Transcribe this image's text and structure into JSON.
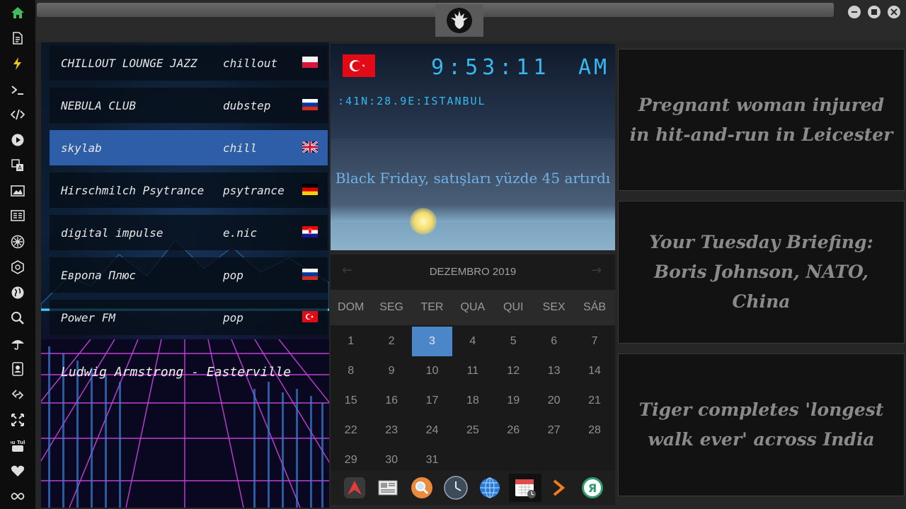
{
  "rail": {
    "icons": [
      "home-icon",
      "document-icon",
      "bolt-icon",
      "terminal-icon",
      "code-icon",
      "play-icon",
      "translate-icon",
      "image-icon",
      "newspaper-icon",
      "rebel-icon",
      "empire-icon",
      "globe-icon",
      "search-icon",
      "umbrella-icon",
      "contacts-icon",
      "link-icon",
      "expand-icon",
      "youtube-icon",
      "heart-icon",
      "infinity-icon"
    ],
    "youtube_label": "You Tube"
  },
  "radio": {
    "stations": [
      {
        "name": "CHILLOUT LOUNGE JAZZ",
        "genre": "chillout",
        "flag": "poland-flag"
      },
      {
        "name": "NEBULA CLUB",
        "genre": "dubstep",
        "flag": "russia-flag"
      },
      {
        "name": "skylab",
        "genre": "chill",
        "flag": "uk-flag"
      },
      {
        "name": "Hirschmilch Psytrance",
        "genre": "psytrance",
        "flag": "germany-flag"
      },
      {
        "name": "digital impulse",
        "genre": "e.nic",
        "flag": "croatia-flag"
      },
      {
        "name": "Европа Плюс",
        "genre": "pop",
        "flag": "russia-flag"
      },
      {
        "name": "Power FM",
        "genre": "pop",
        "flag": "turkey-flag"
      }
    ],
    "active_index": 2,
    "now_playing": "Ludwig Armstrong - Easterville"
  },
  "clock": {
    "flag": "turkey-flag",
    "time": "9:53:11",
    "ampm": "AM",
    "coords": ":41N:28.9E:ISTANBUL",
    "headline": "Black Friday, satışları yüzde 45 artırdı"
  },
  "calendar": {
    "month": "DEZEMBRO 2019",
    "prev": "←",
    "next": "→",
    "weekdays": [
      "DOM",
      "SEG",
      "TER",
      "QUA",
      "QUI",
      "SEX",
      "SÁB"
    ],
    "weeks": [
      [
        "1",
        "2",
        "3",
        "4",
        "5",
        "6",
        "7"
      ],
      [
        "8",
        "9",
        "10",
        "11",
        "12",
        "13",
        "14"
      ],
      [
        "15",
        "16",
        "17",
        "18",
        "19",
        "20",
        "21"
      ],
      [
        "22",
        "23",
        "24",
        "25",
        "26",
        "27",
        "28"
      ],
      [
        "29",
        "30",
        "31",
        "",
        "",
        "",
        ""
      ]
    ],
    "today": "3"
  },
  "dock": {
    "items": [
      "app-launcher-icon",
      "news-reader-icon",
      "search-app-icon",
      "clock-app-icon",
      "browser-icon",
      "calendar-app-icon",
      "forward-icon",
      "yandex-icon"
    ],
    "yandex_letter": "Я"
  },
  "news": [
    "Pregnant woman injured in hit-and-run in Leicester",
    "Your Tuesday Briefing: Boris Johnson, NATO, China",
    "Tiger completes 'longest walk ever' across India"
  ]
}
